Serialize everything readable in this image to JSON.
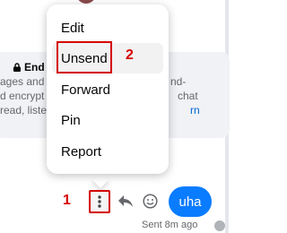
{
  "menu": {
    "items": [
      {
        "label": "Edit"
      },
      {
        "label": "Unsend"
      },
      {
        "label": "Forward"
      },
      {
        "label": "Pin"
      },
      {
        "label": "Report"
      }
    ]
  },
  "annotations": {
    "marker_1": "1",
    "marker_2": "2"
  },
  "encryption_notice": {
    "title": "End",
    "line1_left": "ages and",
    "line1_right": "nd-",
    "line2_left": "d encrypt",
    "line2_right": "chat",
    "line3_left": "read, liste",
    "line3_right": "rn"
  },
  "message": {
    "text": "uha",
    "status": "Sent 8m ago"
  },
  "colors": {
    "accent": "#0a7cff",
    "annotation": "#d40000"
  }
}
